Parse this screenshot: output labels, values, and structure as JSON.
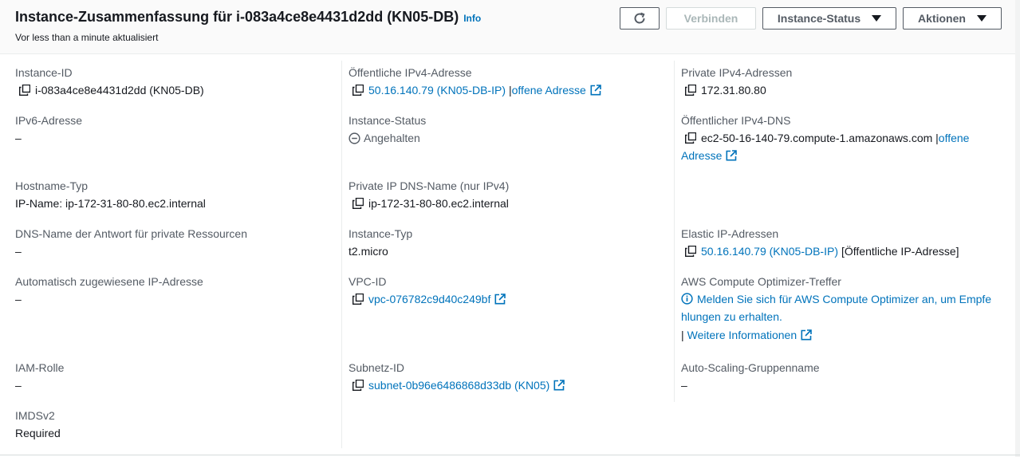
{
  "header": {
    "title": "Instance-Zusammenfassung für i-083a4ce8e4431d2dd (KN05-DB)",
    "info_label": "Info",
    "subtitle": "Vor less than a minute aktualisiert",
    "buttons": {
      "refresh_icon": "refresh-icon",
      "connect": "Verbinden",
      "instance_state": "Instance-Status",
      "actions": "Aktionen"
    }
  },
  "details": {
    "instance_id": {
      "label": "Instance-ID",
      "value": "i-083a4ce8e4431d2dd (KN05-DB)"
    },
    "public_ipv4": {
      "label": "Öffentliche IPv4-Adresse",
      "value": "50.16.140.79 (KN05-DB-IP)",
      "separator": "|",
      "link": "offene Adresse"
    },
    "private_ipv4": {
      "label": "Private IPv4-Adressen",
      "value": "172.31.80.80"
    },
    "ipv6": {
      "label": "IPv6-Adresse",
      "value": "–"
    },
    "instance_status": {
      "label": "Instance-Status",
      "value": "Angehalten"
    },
    "public_dns": {
      "label": "Öffentlicher IPv4-DNS",
      "value": "ec2-50-16-140-79.compute-1.amazonaws.com",
      "separator": "|",
      "link": "offene Adresse"
    },
    "hostname_type": {
      "label": "Hostname-Typ",
      "value": "IP-Name: ip-172-31-80-80.ec2.internal"
    },
    "private_dns": {
      "label": "Private IP DNS-Name (nur IPv4)",
      "value": "ip-172-31-80-80.ec2.internal"
    },
    "resource_dns": {
      "label": "DNS-Name der Antwort für private Ressourcen",
      "value": "–"
    },
    "instance_type": {
      "label": "Instance-Typ",
      "value": "t2.micro"
    },
    "elastic_ip": {
      "label": "Elastic IP-Adressen",
      "value": "50.16.140.79 (KN05-DB-IP)",
      "suffix": "[Öffentliche IP-Adresse]"
    },
    "auto_ip": {
      "label": "Automatisch zugewiesene IP-Adresse",
      "value": "–"
    },
    "vpc_id": {
      "label": "VPC-ID",
      "value": "vpc-076782c9d40c249bf"
    },
    "optimizer": {
      "label": "AWS Compute Optimizer-Treffer",
      "message": "Melden Sie sich für AWS Compute Optimizer an, um Empfe hlungen zu erhalten.",
      "separator": "|",
      "more": "Weitere Informationen"
    },
    "iam_role": {
      "label": "IAM-Rolle",
      "value": "–"
    },
    "subnet_id": {
      "label": "Subnetz-ID",
      "value": "subnet-0b96e6486868d33db (KN05)"
    },
    "asg_name": {
      "label": "Auto-Scaling-Gruppenname",
      "value": "–"
    },
    "imdsv2": {
      "label": "IMDSv2",
      "value": "Required"
    }
  },
  "colors": {
    "link": "#0073bb",
    "label": "#545b64",
    "text": "#16191f"
  }
}
